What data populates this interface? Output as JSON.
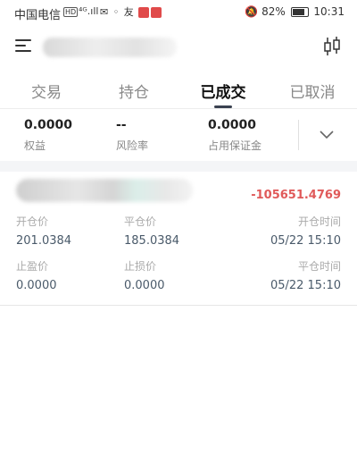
{
  "status_bar": {
    "carrier": "中国电信",
    "net_badge": "HD",
    "signal_text": "⁴ᴳ.ıll",
    "apps_text": "✉ ◦ 友",
    "battery": "82%",
    "time": "10:31"
  },
  "tabs": [
    {
      "label": "交易",
      "active": false
    },
    {
      "label": "持仓",
      "active": false
    },
    {
      "label": "已成交",
      "active": true
    },
    {
      "label": "已取消",
      "active": false
    }
  ],
  "summary": {
    "equity_value": "0.0000",
    "equity_label": "权益",
    "risk_value": "--",
    "risk_label": "风险率",
    "margin_value": "0.0000",
    "margin_label": "占用保证金"
  },
  "trade": {
    "pnl": "-105651.4769",
    "open_price_label": "开仓价",
    "open_price": "201.0384",
    "close_price_label": "平仓价",
    "close_price": "185.0384",
    "open_time_label": "开仓时间",
    "open_time": "05/22 15:10",
    "take_profit_label": "止盈价",
    "take_profit": "0.0000",
    "stop_loss_label": "止损价",
    "stop_loss": "0.0000",
    "close_time_label": "平仓时间",
    "close_time": "05/22 15:10"
  },
  "colors": {
    "pnl_negative": "#e05a5a",
    "active_tab": "#111111",
    "inactive_tab": "#888888"
  }
}
